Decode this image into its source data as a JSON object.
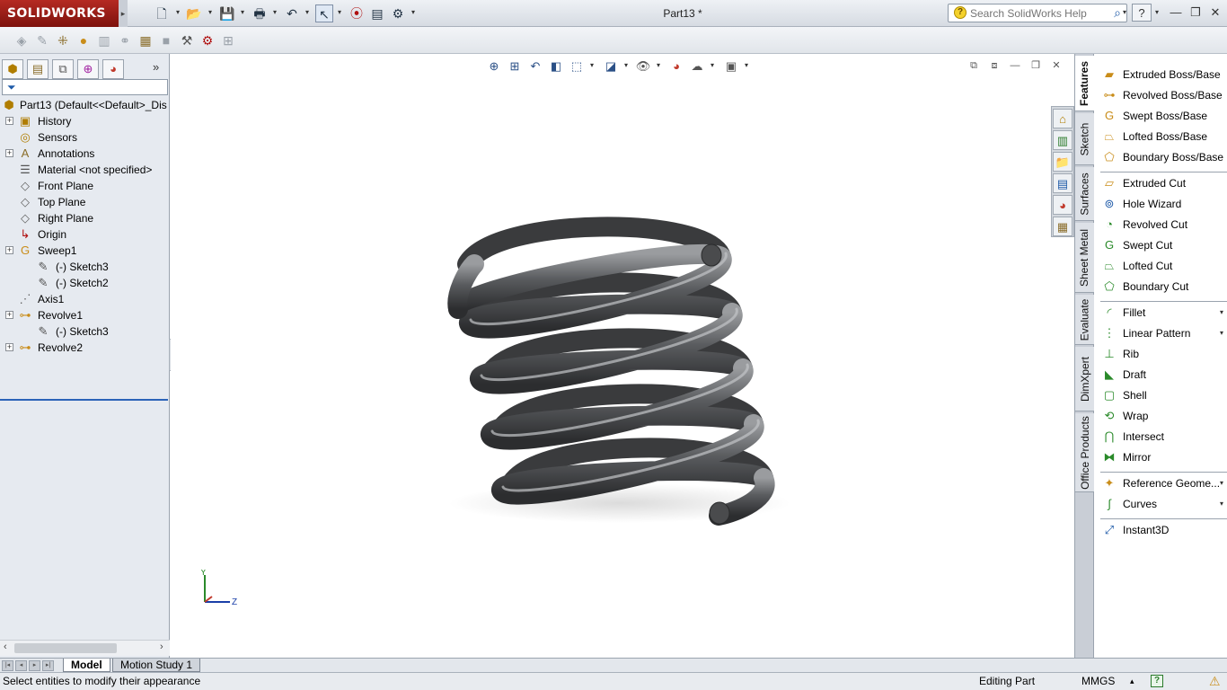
{
  "app": {
    "logo_text": "SOLIDWORKS",
    "document_title": "Part13 *"
  },
  "help_search": {
    "placeholder": "Search SolidWorks Help"
  },
  "quick_access": {
    "icons": [
      "new-document-icon",
      "open-folder-icon",
      "save-icon",
      "print-icon",
      "undo-icon",
      "select-pointer-icon",
      "rebuild-traffic-light-icon",
      "file-properties-icon",
      "options-icon"
    ]
  },
  "feature_manager": {
    "tabs": [
      "feature-manager-tab",
      "property-manager-tab",
      "configuration-manager-tab",
      "dimxpert-manager-tab",
      "display-manager-tab"
    ],
    "root_label": "Part13  (Default<<Default>_Dis",
    "items": [
      {
        "label": "History",
        "icon": "history-folder-icon",
        "expandable": true,
        "indent": 1
      },
      {
        "label": "Sensors",
        "icon": "sensors-icon",
        "expandable": false,
        "indent": 1
      },
      {
        "label": "Annotations",
        "icon": "annotations-icon",
        "expandable": true,
        "indent": 1
      },
      {
        "label": "Material <not specified>",
        "icon": "material-icon",
        "expandable": false,
        "indent": 1
      },
      {
        "label": "Front Plane",
        "icon": "plane-icon",
        "expandable": false,
        "indent": 1
      },
      {
        "label": "Top Plane",
        "icon": "plane-icon",
        "expandable": false,
        "indent": 1
      },
      {
        "label": "Right Plane",
        "icon": "plane-icon",
        "expandable": false,
        "indent": 1
      },
      {
        "label": "Origin",
        "icon": "origin-icon",
        "expandable": false,
        "indent": 1
      },
      {
        "label": "Sweep1",
        "icon": "sweep-icon",
        "expandable": true,
        "indent": 1
      },
      {
        "label": "(-) Sketch3",
        "icon": "sketch-icon",
        "expandable": false,
        "indent": 2
      },
      {
        "label": "(-) Sketch2",
        "icon": "sketch-icon",
        "expandable": false,
        "indent": 2
      },
      {
        "label": "Axis1",
        "icon": "axis-icon",
        "expandable": false,
        "indent": 1
      },
      {
        "label": "Revolve1",
        "icon": "revolve-icon",
        "expandable": true,
        "indent": 1
      },
      {
        "label": "(-) Sketch3",
        "icon": "sketch-icon",
        "expandable": false,
        "indent": 2
      },
      {
        "label": "Revolve2",
        "icon": "revolve-icon",
        "expandable": true,
        "indent": 1
      }
    ]
  },
  "task_pane_tabs": [
    "Features",
    "Sketch",
    "Surfaces",
    "Sheet Metal",
    "Evaluate",
    "DimXpert",
    "Office Products"
  ],
  "command_manager": {
    "groups": [
      [
        {
          "label": "Extruded Boss/Base",
          "icon": "extruded-boss-icon"
        },
        {
          "label": "Revolved Boss/Base",
          "icon": "revolved-boss-icon"
        },
        {
          "label": "Swept Boss/Base",
          "icon": "swept-boss-icon"
        },
        {
          "label": "Lofted Boss/Base",
          "icon": "lofted-boss-icon"
        },
        {
          "label": "Boundary Boss/Base",
          "icon": "boundary-boss-icon"
        }
      ],
      [
        {
          "label": "Extruded Cut",
          "icon": "extruded-cut-icon"
        },
        {
          "label": "Hole Wizard",
          "icon": "hole-wizard-icon"
        },
        {
          "label": "Revolved Cut",
          "icon": "revolved-cut-icon"
        },
        {
          "label": "Swept Cut",
          "icon": "swept-cut-icon"
        },
        {
          "label": "Lofted Cut",
          "icon": "lofted-cut-icon"
        },
        {
          "label": "Boundary Cut",
          "icon": "boundary-cut-icon"
        }
      ],
      [
        {
          "label": "Fillet",
          "icon": "fillet-icon",
          "dropdown": true
        },
        {
          "label": "Linear Pattern",
          "icon": "linear-pattern-icon",
          "dropdown": true
        },
        {
          "label": "Rib",
          "icon": "rib-icon"
        },
        {
          "label": "Draft",
          "icon": "draft-icon"
        },
        {
          "label": "Shell",
          "icon": "shell-icon"
        },
        {
          "label": "Wrap",
          "icon": "wrap-icon"
        },
        {
          "label": "Intersect",
          "icon": "intersect-icon"
        },
        {
          "label": "Mirror",
          "icon": "mirror-icon"
        }
      ],
      [
        {
          "label": "Reference Geome...",
          "icon": "reference-geometry-icon",
          "dropdown": true
        },
        {
          "label": "Curves",
          "icon": "curves-icon",
          "dropdown": true
        }
      ],
      [
        {
          "label": "Instant3D",
          "icon": "instant3d-icon"
        }
      ]
    ]
  },
  "triad": {
    "y_label": "Y",
    "z_label": "Z"
  },
  "bottom_tabs": {
    "model": "Model",
    "motion_study": "Motion Study 1"
  },
  "status_bar": {
    "message": "Select entities to modify their appearance",
    "mode": "Editing Part",
    "units": "MMGS"
  },
  "colors": {
    "logo_red": "#a01d16",
    "accent_blue": "#2b63b8",
    "spring_gray": "#5a5c5f"
  }
}
